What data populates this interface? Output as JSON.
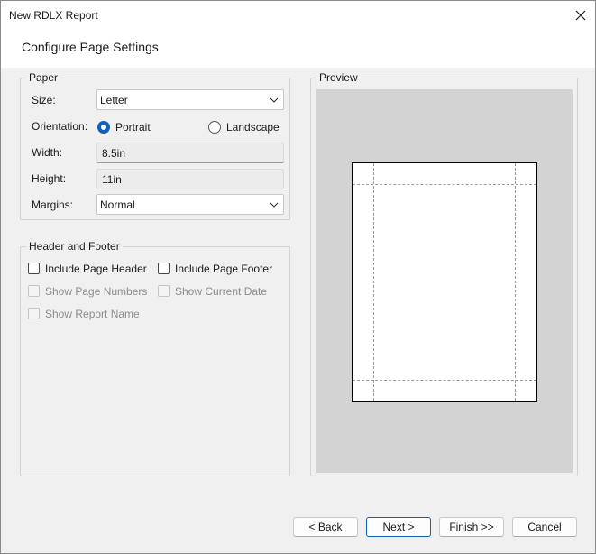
{
  "window": {
    "title": "New RDLX Report"
  },
  "header": {
    "title": "Configure Page Settings"
  },
  "paper": {
    "legend": "Paper",
    "size_label": "Size:",
    "size_value": "Letter",
    "orientation_label": "Orientation:",
    "orientation_options": [
      "Portrait",
      "Landscape"
    ],
    "orientation_selected": "Portrait",
    "width_label": "Width:",
    "width_value": "8.5in",
    "height_label": "Height:",
    "height_value": "11in",
    "margins_label": "Margins:",
    "margins_value": "Normal"
  },
  "header_footer": {
    "legend": "Header and Footer",
    "options": [
      {
        "label": "Include Page Header",
        "checked": false,
        "enabled": true
      },
      {
        "label": "Include Page Footer",
        "checked": false,
        "enabled": true
      },
      {
        "label": "Show Page Numbers",
        "checked": false,
        "enabled": false
      },
      {
        "label": "Show Current Date",
        "checked": false,
        "enabled": false
      },
      {
        "label": "Show Report Name",
        "checked": false,
        "enabled": false
      }
    ]
  },
  "preview": {
    "legend": "Preview"
  },
  "buttons": {
    "back": "< Back",
    "next": "Next >",
    "finish": "Finish >>",
    "cancel": "Cancel"
  },
  "icons": {
    "close": "close-icon",
    "dropdown": "chevron-down-icon"
  },
  "colors": {
    "accent": "#0f5fbf",
    "preview_bg": "#d3d3d3",
    "dialog_bg": "#f0f0f0"
  }
}
